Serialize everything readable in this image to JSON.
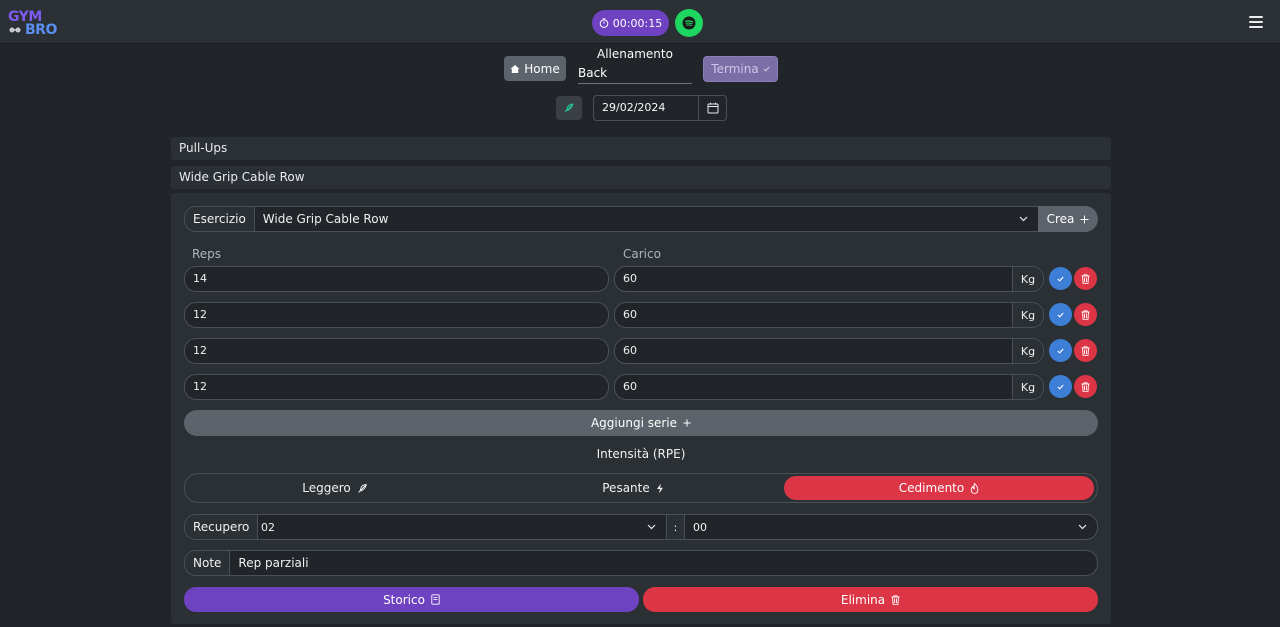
{
  "header": {
    "logo_top": "GYM",
    "logo_bottom": "BRO",
    "timer": "00:00:15",
    "menu_icon": "hamburger-icon",
    "spotify_icon": "spotify-icon"
  },
  "workout": {
    "home_label": "Home",
    "title_label": "Allenamento",
    "name": "Back",
    "end_label": "Termina",
    "date": "29/02/2024"
  },
  "exercises": {
    "collapsed": [
      "Pull-Ups",
      "Wide Grip Cable Row"
    ]
  },
  "editor": {
    "exercise_label": "Esercizio",
    "exercise_value": "Wide Grip Cable Row",
    "create_label": "Crea",
    "reps_header": "Reps",
    "load_header": "Carico",
    "unit": "Kg",
    "sets": [
      {
        "reps": "14",
        "load": "60"
      },
      {
        "reps": "12",
        "load": "60"
      },
      {
        "reps": "12",
        "load": "60"
      },
      {
        "reps": "12",
        "load": "60"
      }
    ],
    "add_set_label": "Aggiungi serie",
    "intensity_label": "Intensità (RPE)",
    "intensity_options": [
      {
        "label": "Leggero",
        "icon": "feather-icon"
      },
      {
        "label": "Pesante",
        "icon": "lightning-icon"
      },
      {
        "label": "Cedimento",
        "icon": "fire-icon"
      }
    ],
    "intensity_selected": "Cedimento",
    "rest_label": "Recupero",
    "rest_minutes": "02",
    "rest_separator": ":",
    "rest_seconds": "00",
    "note_label": "Note",
    "note_value": "Rep parziali",
    "history_label": "Storico",
    "delete_label": "Elimina"
  },
  "colors": {
    "background": "#212529",
    "panel": "#2b3035",
    "accent_purple": "#6f42c1",
    "danger": "#dc3545",
    "primary_blue": "#3d7ed6",
    "spotify_green": "#1ed760"
  }
}
